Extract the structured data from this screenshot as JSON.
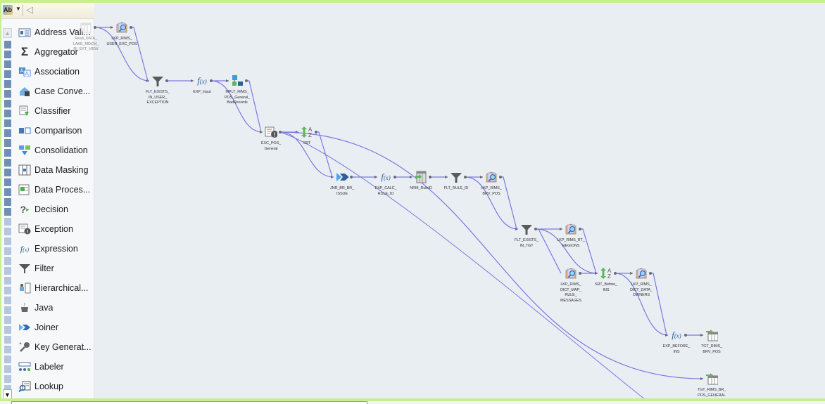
{
  "palette": {
    "toolbar": {
      "view_icon": "text-label-view-icon",
      "view_label": "Ab",
      "dropdown_icon": "caret-down-icon",
      "collapse_icon": "collapse-left-icon"
    },
    "scroll_up": "▲",
    "scroll_down": "▼",
    "items": [
      {
        "label": "Address Vali...",
        "icon": "address-validator-icon"
      },
      {
        "label": "Aggregator",
        "icon": "sigma-icon"
      },
      {
        "label": "Association",
        "icon": "association-icon"
      },
      {
        "label": "Case Conve...",
        "icon": "case-converter-icon"
      },
      {
        "label": "Classifier",
        "icon": "classifier-icon"
      },
      {
        "label": "Comparison",
        "icon": "comparison-icon"
      },
      {
        "label": "Consolidation",
        "icon": "consolidation-icon"
      },
      {
        "label": "Data Masking",
        "icon": "data-masking-icon"
      },
      {
        "label": "Data Proces...",
        "icon": "data-processor-icon"
      },
      {
        "label": "Decision",
        "icon": "decision-icon"
      },
      {
        "label": "Exception",
        "icon": "exception-icon"
      },
      {
        "label": "Expression",
        "icon": "expression-icon"
      },
      {
        "label": "Filter",
        "icon": "filter-icon"
      },
      {
        "label": "Hierarchical...",
        "icon": "hierarchical-icon"
      },
      {
        "label": "Java",
        "icon": "java-icon"
      },
      {
        "label": "Joiner",
        "icon": "joiner-icon"
      },
      {
        "label": "Key Generat...",
        "icon": "key-generator-icon"
      },
      {
        "label": "Labeler",
        "icon": "labeler-icon"
      },
      {
        "label": "Lookup",
        "icon": "lookup-icon"
      }
    ]
  },
  "mapping": {
    "nodes": [
      {
        "id": "src",
        "type": "source",
        "label": "Read_DATA_\nLAKE_MDCM_\nRI_EXT_VIEW"
      },
      {
        "id": "lkp_user",
        "type": "lookup",
        "label": "LKP_RIMS_\nUSER_EXC_POS"
      },
      {
        "id": "flt_user",
        "type": "filter",
        "label": "FLT_EXISTS_\nIN_USER_\nEXCEPTION"
      },
      {
        "id": "exp_input",
        "type": "expression",
        "label": "EXP_Input"
      },
      {
        "id": "mplt",
        "type": "mapplet",
        "label": "MPLT_RIMS_\nPOS_General_\nBadRecords"
      },
      {
        "id": "exc",
        "type": "exception",
        "label": "EXC_POS_\nGeneral"
      },
      {
        "id": "srt",
        "type": "sorter",
        "label": "SRT"
      },
      {
        "id": "jnr",
        "type": "joiner",
        "label": "JNR_BR_BR_\nISSUE"
      },
      {
        "id": "exp_calc",
        "type": "expression",
        "label": "EXP_CALC_\nRULE_ID"
      },
      {
        "id": "nrm",
        "type": "normalizer",
        "label": "NRM_RuleID"
      },
      {
        "id": "flt_rule",
        "type": "filter",
        "label": "FLT_RULE_ID"
      },
      {
        "id": "lkp_brv",
        "type": "lookup",
        "label": "LKP_RIMS_\nBRV_POS"
      },
      {
        "id": "flt_tgt",
        "type": "filter",
        "label": "FLT_EXISTS_\nIN_TGT"
      },
      {
        "id": "lkp_rt",
        "type": "lookup",
        "label": "LKP_RIMS_RT_\nREGIONS"
      },
      {
        "id": "lkp_dict",
        "type": "lookup",
        "label": "LKP_RIMS_\nDICT_MAP_\nRULE_\nMESSAGES"
      },
      {
        "id": "srt_before",
        "type": "sorter",
        "label": "SRT_Before_\nINS"
      },
      {
        "id": "lkp_owners",
        "type": "lookup",
        "label": "LKP_RIMS_\nDICT_DATA_\nOWNERS"
      },
      {
        "id": "exp_before",
        "type": "expression",
        "label": "EXP_BEFORE_\nINS"
      },
      {
        "id": "tgt_brv",
        "type": "target",
        "label": "TGT_RIMS_\nBRV_POS"
      },
      {
        "id": "tgt_general",
        "type": "target",
        "label": "TGT_RIMS_BR_\nPOS_GENERAL"
      }
    ]
  },
  "colors": {
    "canvas_bg": "#e9eef3",
    "link": "#7b78e0",
    "accent_bar": "#c6ef8e"
  }
}
